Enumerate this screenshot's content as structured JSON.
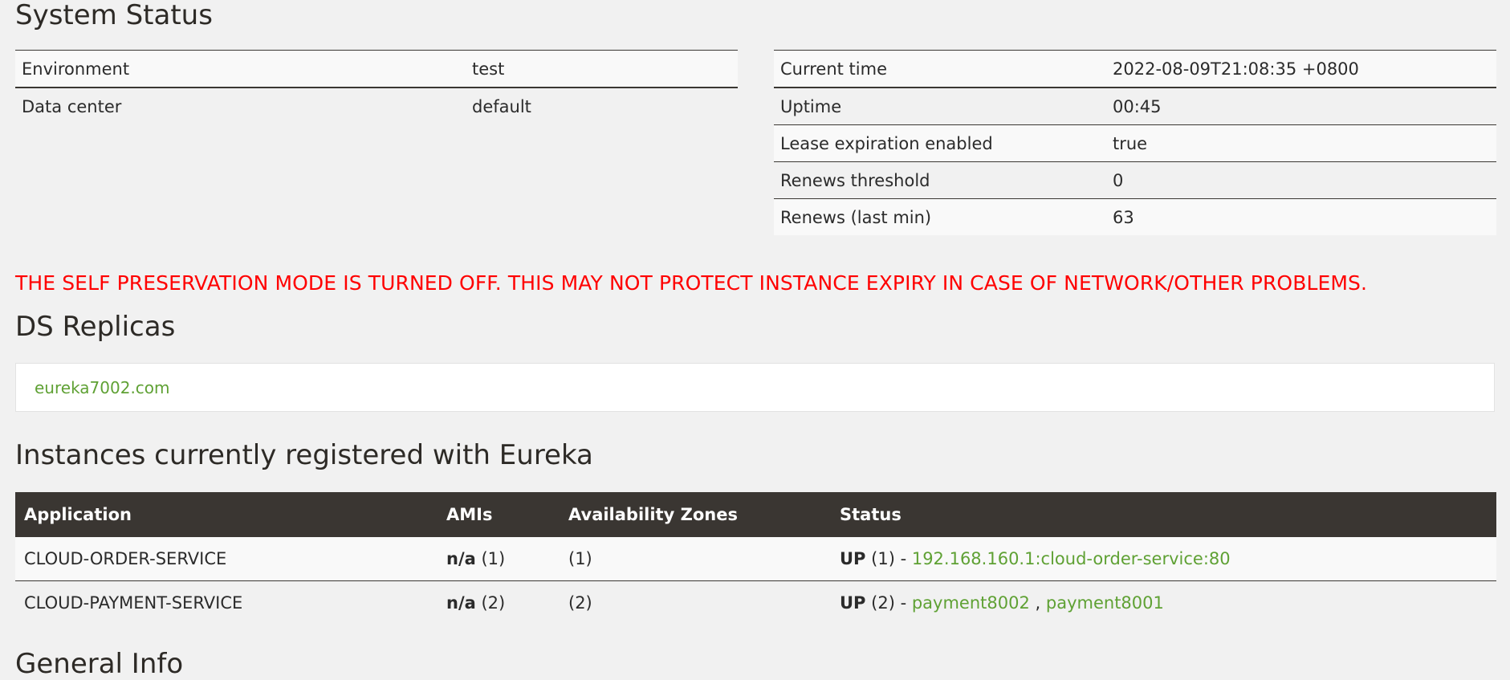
{
  "system_status": {
    "title": "System Status",
    "left": [
      {
        "key": "Environment",
        "value": "test"
      },
      {
        "key": "Data center",
        "value": "default"
      }
    ],
    "right": [
      {
        "key": "Current time",
        "value": "2022-08-09T21:08:35 +0800"
      },
      {
        "key": "Uptime",
        "value": "00:45"
      },
      {
        "key": "Lease expiration enabled",
        "value": "true"
      },
      {
        "key": "Renews threshold",
        "value": "0"
      },
      {
        "key": "Renews (last min)",
        "value": "63"
      }
    ]
  },
  "warning": "THE SELF PRESERVATION MODE IS TURNED OFF. THIS MAY NOT PROTECT INSTANCE EXPIRY IN CASE OF NETWORK/OTHER PROBLEMS.",
  "ds_replicas": {
    "title": "DS Replicas",
    "replica": "eureka7002.com"
  },
  "instances": {
    "title": "Instances currently registered with Eureka",
    "headers": [
      "Application",
      "AMIs",
      "Availability Zones",
      "Status"
    ],
    "rows": [
      {
        "application": "CLOUD-ORDER-SERVICE",
        "amis_label": "n/a",
        "amis_count": "(1)",
        "zones": "(1)",
        "status_label": "UP",
        "status_count": "(1) -",
        "links": [
          "192.168.160.1:cloud-order-service:80"
        ]
      },
      {
        "application": "CLOUD-PAYMENT-SERVICE",
        "amis_label": "n/a",
        "amis_count": "(2)",
        "zones": "(2)",
        "status_label": "UP",
        "status_count": "(2) -",
        "links": [
          "payment8002",
          "payment8001"
        ],
        "separator": ","
      }
    ]
  },
  "general_info": {
    "title": "General Info"
  },
  "colors": {
    "link": "#5fa134",
    "warning": "#ff0000",
    "header_bg": "#3a3632",
    "page_bg": "#f1f1f1"
  }
}
